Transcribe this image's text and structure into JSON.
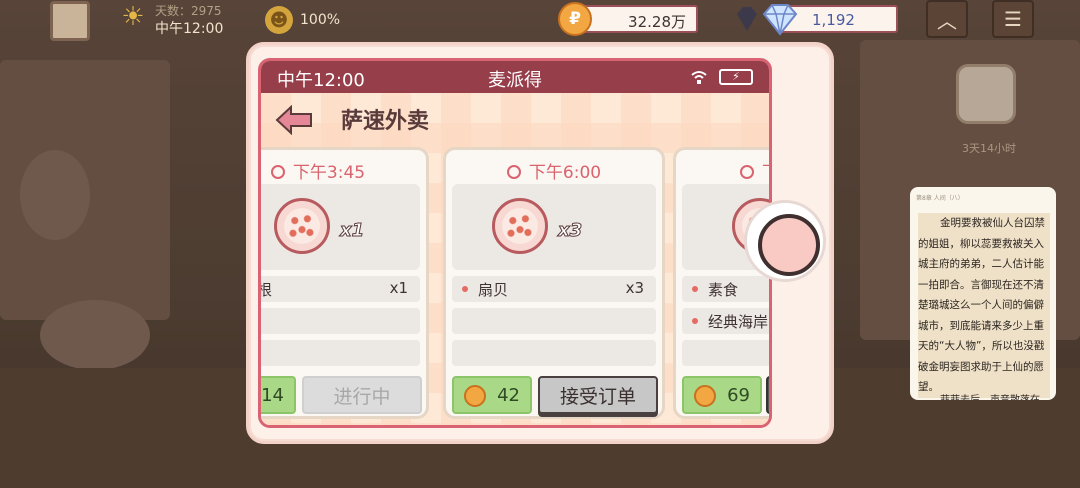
{
  "hud": {
    "days": "天数：2975",
    "clock": "中午12:00",
    "mood": "100%",
    "coins": "32.28万",
    "gems": "1,192"
  },
  "bg": {
    "timer": "3天14小时"
  },
  "phone": {
    "time": "中午12:00",
    "app_name": "麦派得",
    "title": "萨速外卖"
  },
  "orders": [
    {
      "time": "下午3:45",
      "dish_qty": "x1",
      "items": [
        {
          "name": "培根",
          "qty": "x1"
        }
      ],
      "reward": "14",
      "action": "进行中"
    },
    {
      "time": "下午6:00",
      "dish_qty": "x3",
      "items": [
        {
          "name": "扇贝",
          "qty": "x3"
        }
      ],
      "reward": "42",
      "action": "接受订单"
    },
    {
      "time": "下午",
      "dish_qty": "",
      "items": [
        {
          "name": "素食",
          "qty": ""
        },
        {
          "name": "经典海岸",
          "qty": ""
        }
      ],
      "reward": "69",
      "action": ""
    }
  ],
  "reader": {
    "header": "第8章 人间（八）",
    "text": "金明要救被仙人台囚禁的姐姐，柳以蕊要救被关入城主府的弟弟，二人估计能一拍即合。言御现在还不清楚璐城这么一个人间的偏僻城市，到底能请来多少上重天的“大人物”，所以也没戳破金明妄图求助于上仙的愿望。",
    "tail": "菲菲去后，声音散落在"
  },
  "colors": {
    "statusbar": "#963e4a",
    "accent": "#d96273",
    "reward_green": "#a9d987",
    "coin": "#f2a743"
  }
}
